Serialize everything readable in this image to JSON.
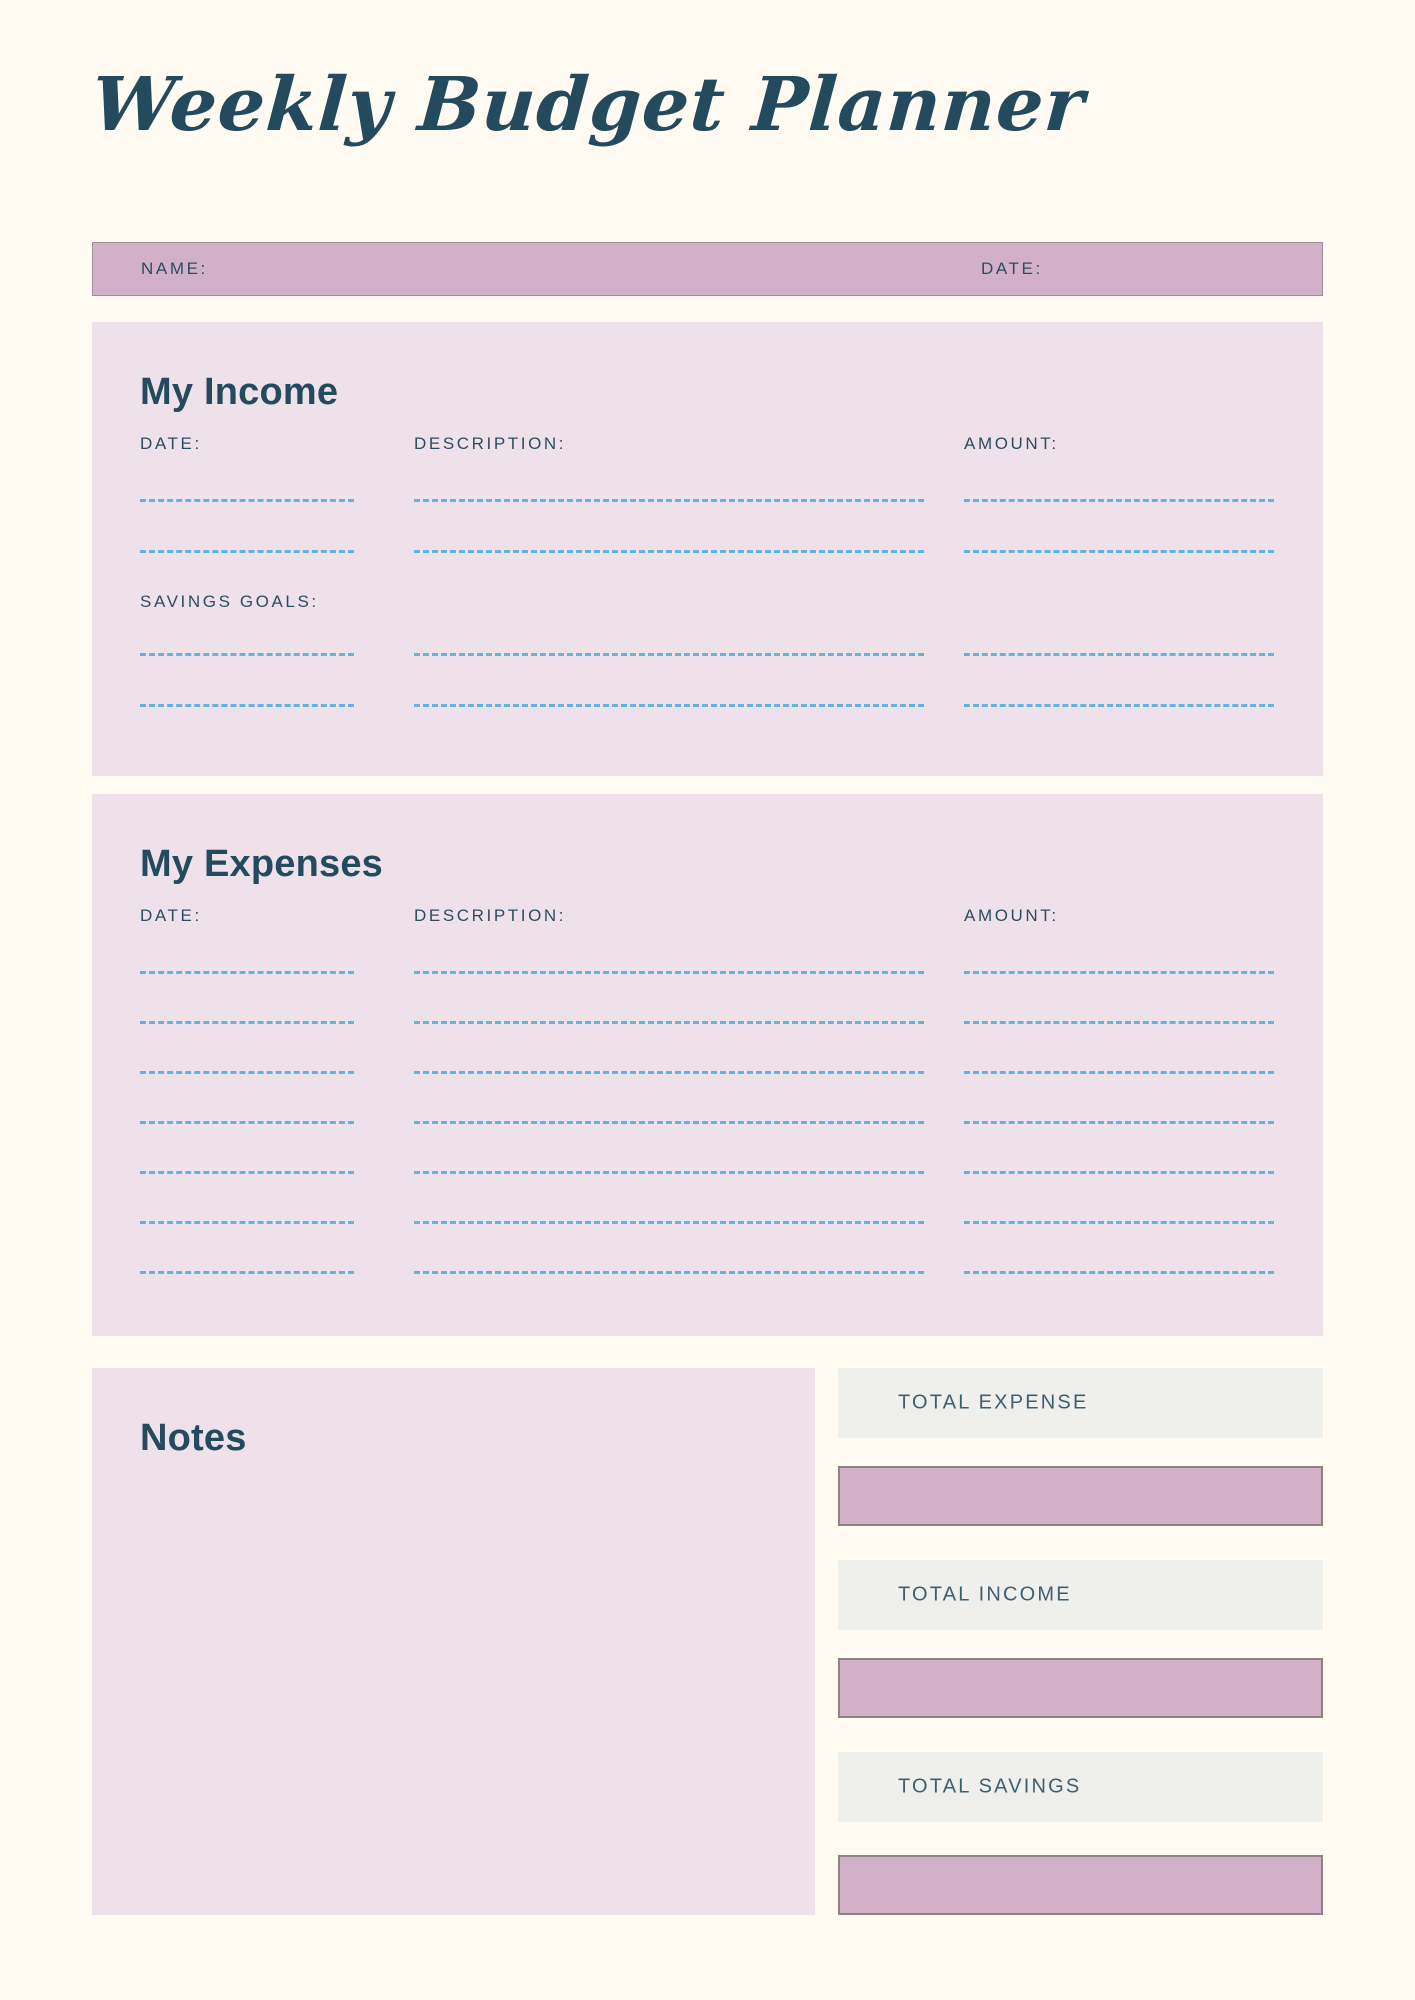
{
  "document": {
    "title": "Weekly Budget Planner",
    "background_color": "#fffbf2",
    "accent_color": "#d2b1c8",
    "panel_color": "#eee1e9",
    "text_color": "#244a5e",
    "rule_color": "#63b3e0"
  },
  "name_bar": {
    "name_label": "NAME:",
    "date_label": "DATE:"
  },
  "income": {
    "heading": "My Income",
    "columns": {
      "date": "DATE:",
      "description": "DESCRIPTION:",
      "amount": "AMOUNT:"
    },
    "savings_goals_label": "SAVINGS GOALS:",
    "entry_rows": 2,
    "savings_rows": 2
  },
  "expenses": {
    "heading": "My Expenses",
    "columns": {
      "date": "DATE:",
      "description": "DESCRIPTION:",
      "amount": "AMOUNT:"
    },
    "entry_rows": 7
  },
  "notes": {
    "heading": "Notes"
  },
  "totals": [
    {
      "label": "TOTAL EXPENSE",
      "value": ""
    },
    {
      "label": "TOTAL INCOME",
      "value": ""
    },
    {
      "label": "TOTAL SAVINGS",
      "value": ""
    }
  ]
}
